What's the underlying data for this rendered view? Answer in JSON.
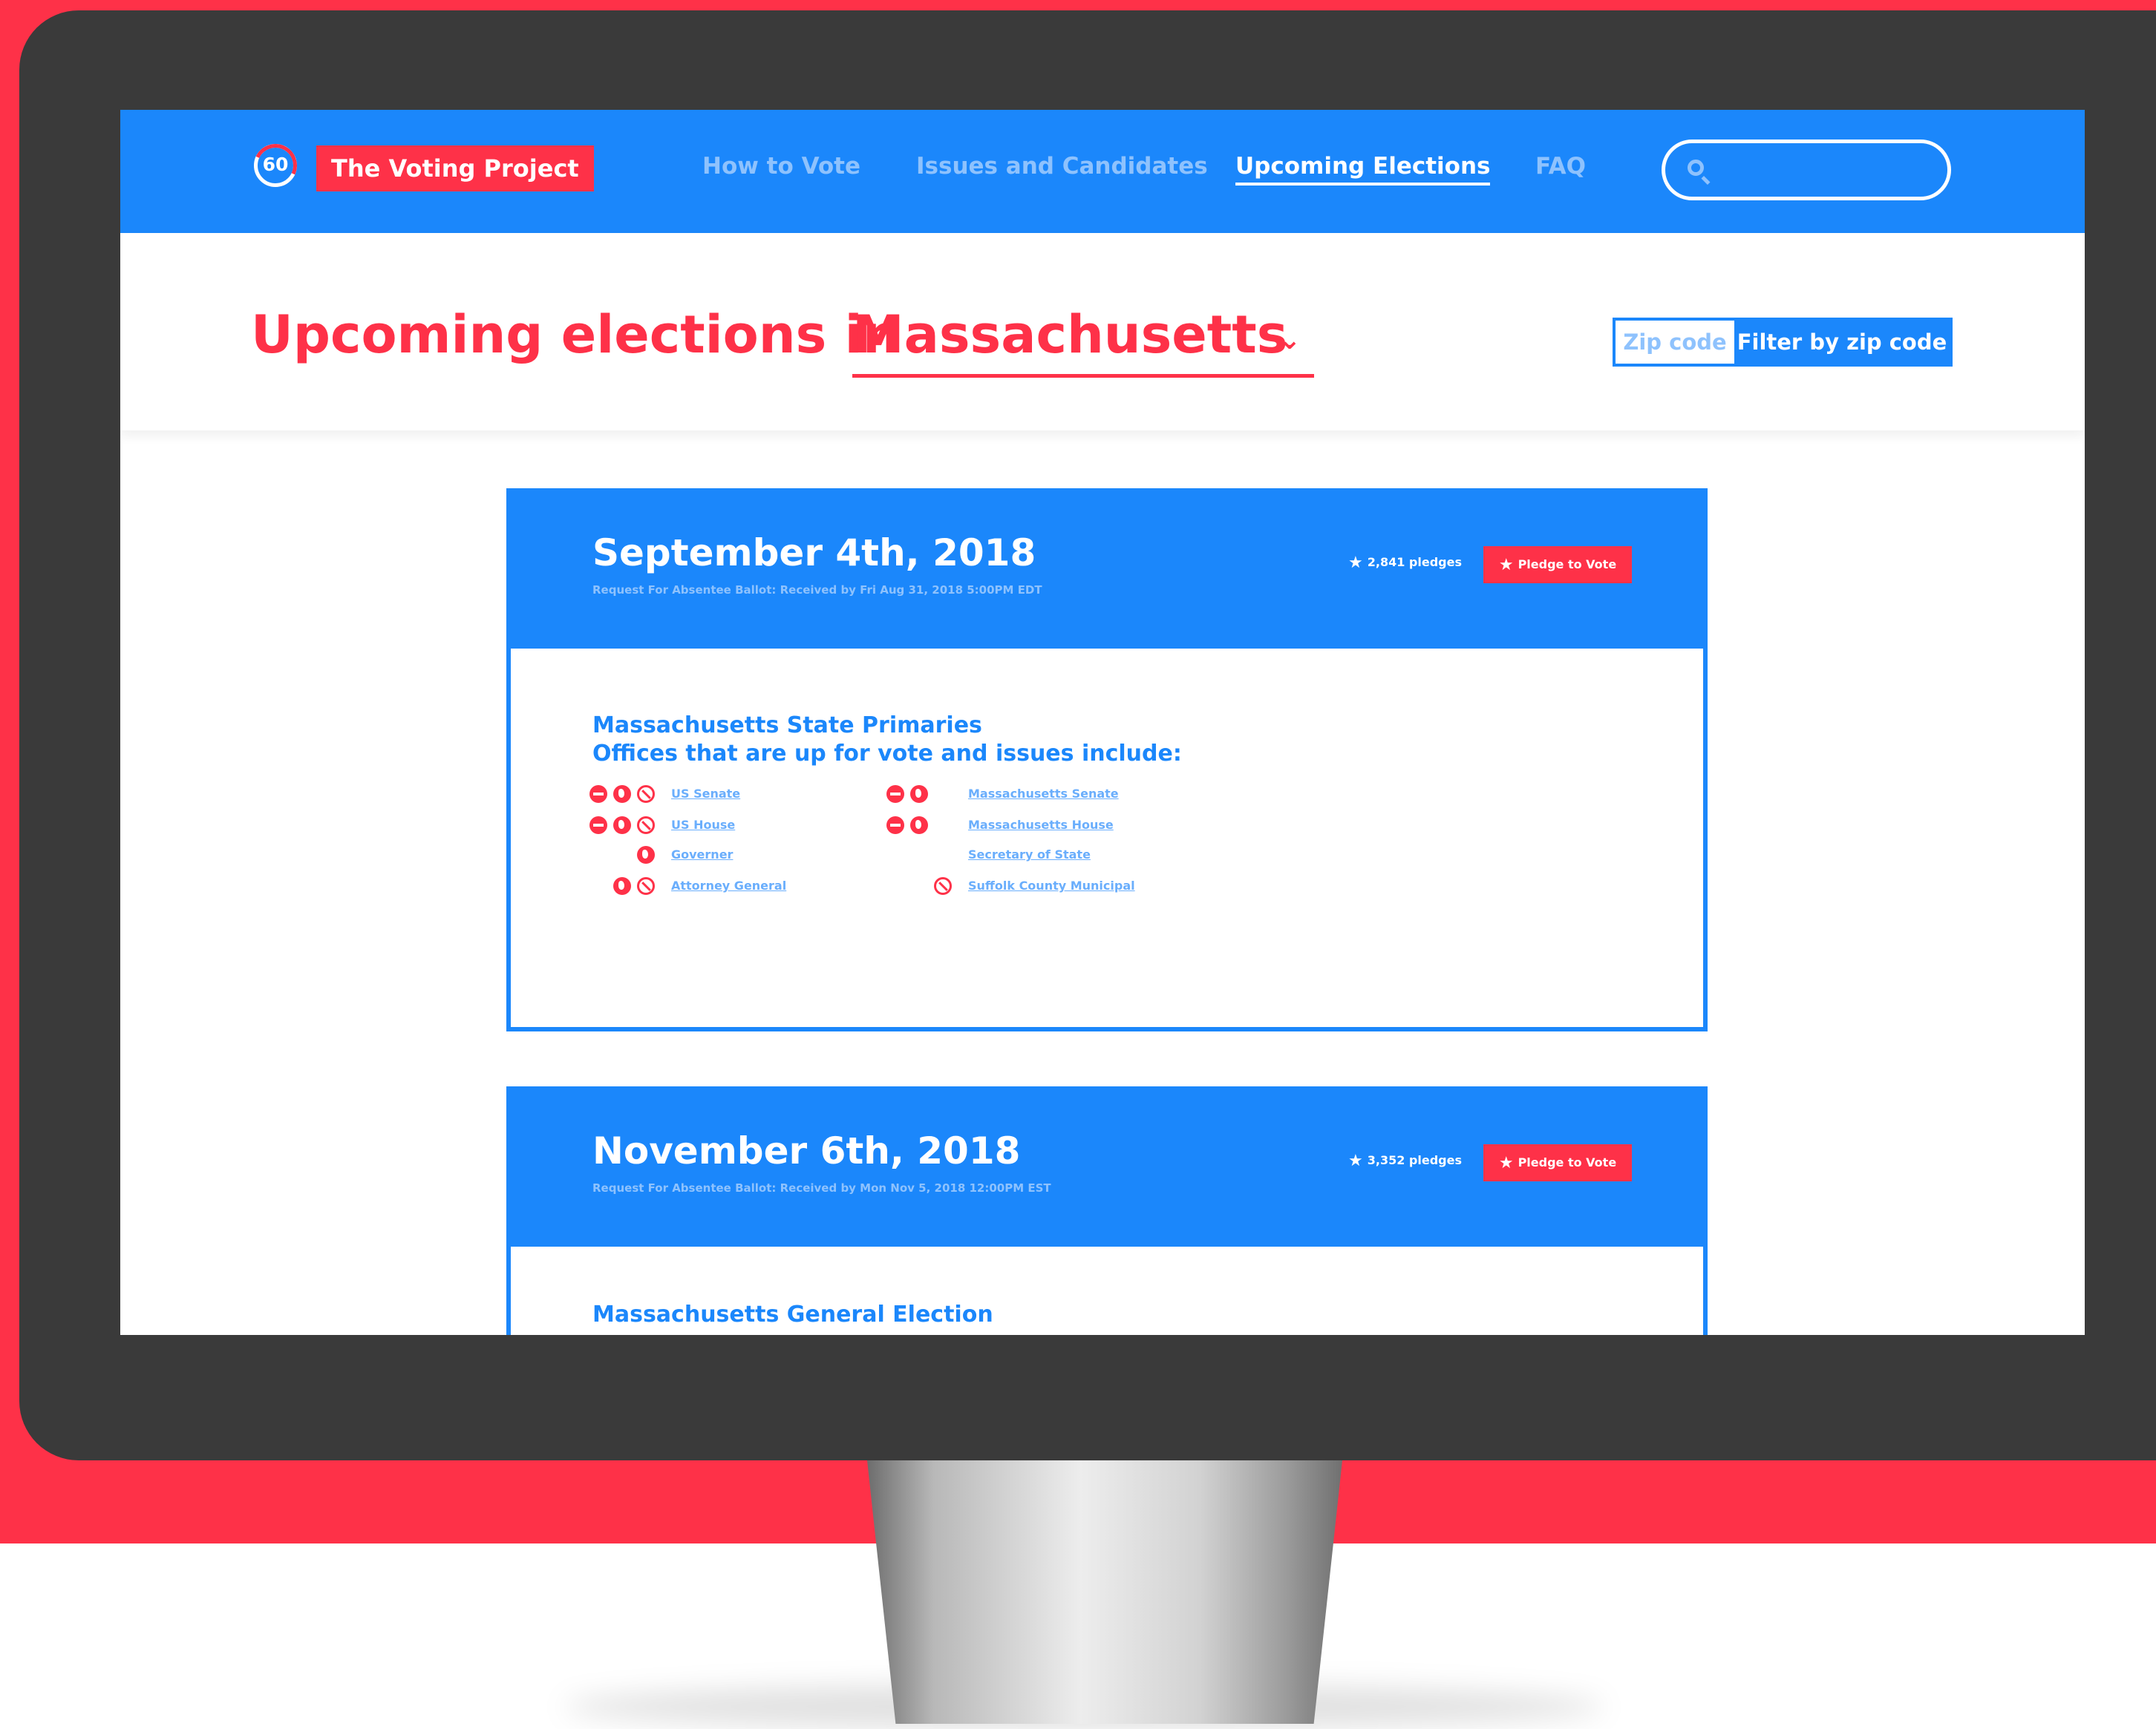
{
  "app": {
    "logo_text": "60",
    "brand": "The Voting Project"
  },
  "nav": {
    "items": [
      {
        "label": "How to Vote",
        "active": false
      },
      {
        "label": "Issues and Candidates",
        "active": false
      },
      {
        "label": "Upcoming Elections",
        "active": true
      },
      {
        "label": "FAQ",
        "active": false
      }
    ],
    "search_placeholder": ""
  },
  "page": {
    "title_prefix": "Upcoming elections in",
    "state": "Massachusetts",
    "zip_placeholder": "Zip code",
    "zip_button": "Filter by zip code"
  },
  "elections": [
    {
      "date": "September 4th, 2018",
      "absentee": "Request For Absentee Ballot: Received by Fri Aug 31, 2018 5:00PM EDT",
      "pledges": "2,841 pledges",
      "pledge_button": "Pledge to Vote",
      "name": "Massachusetts State Primaries",
      "subtitle": "Offices that are up for vote and issues include:",
      "offices_left": [
        "US Senate",
        "US House",
        "Governer",
        "Attorney General"
      ],
      "offices_right": [
        "Massachusetts Senate",
        "Massachusetts House",
        "Secretary of State",
        "Suffolk County Municipal"
      ]
    },
    {
      "date": "November 6th, 2018",
      "absentee": "Request For Absentee Ballot: Received by Mon Nov 5, 2018 12:00PM EST",
      "pledges": "3,352 pledges",
      "pledge_button": "Pledge to Vote",
      "name": "Massachusetts General Election"
    }
  ],
  "colors": {
    "brand_blue": "#1b87fb",
    "brand_red": "#fe3148",
    "muted_blue": "#8ec2fd",
    "bezel": "#3a3a3a"
  }
}
